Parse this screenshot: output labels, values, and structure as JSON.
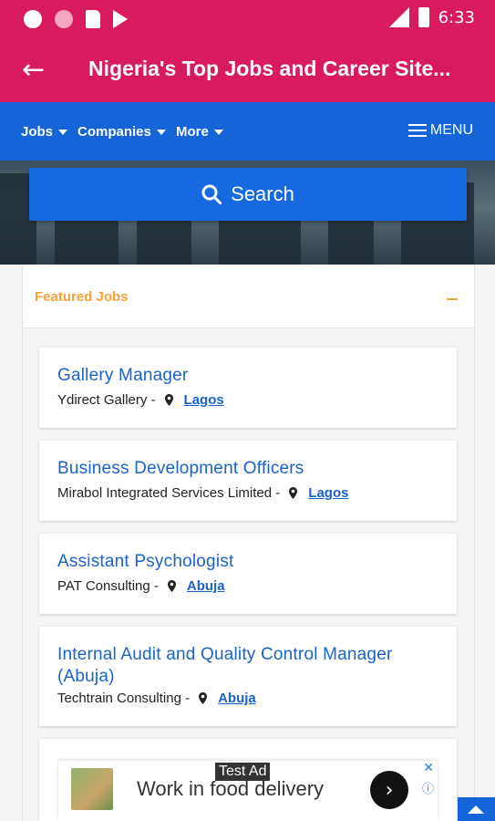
{
  "status_bar": {
    "time": "6:33"
  },
  "app_bar": {
    "title": "Nigeria's Top Jobs and Career Site..."
  },
  "nav": {
    "items": [
      {
        "label": "Jobs"
      },
      {
        "label": "Companies"
      },
      {
        "label": "More"
      }
    ],
    "menu_label": "MENU"
  },
  "search": {
    "label": "Search"
  },
  "featured": {
    "title": "Featured Jobs",
    "jobs": [
      {
        "title": "Gallery Manager",
        "company": "Ydirect Gallery -",
        "location": "Lagos"
      },
      {
        "title": "Business Development Officers",
        "company": "Mirabol Integrated Services Limited -",
        "location": "Lagos"
      },
      {
        "title": "Assistant Psychologist",
        "company": "PAT Consulting -",
        "location": "Abuja"
      },
      {
        "title": "Internal Audit and Quality Control Manager (Abuja)",
        "company": "Techtrain Consulting -",
        "location": "Abuja"
      }
    ]
  },
  "ad": {
    "label": "Test Ad",
    "text": "Work in food delivery"
  },
  "colors": {
    "primary": "#d81b5f",
    "nav": "#1565d8",
    "accent": "#f7a13a",
    "link": "#1a63c9"
  }
}
